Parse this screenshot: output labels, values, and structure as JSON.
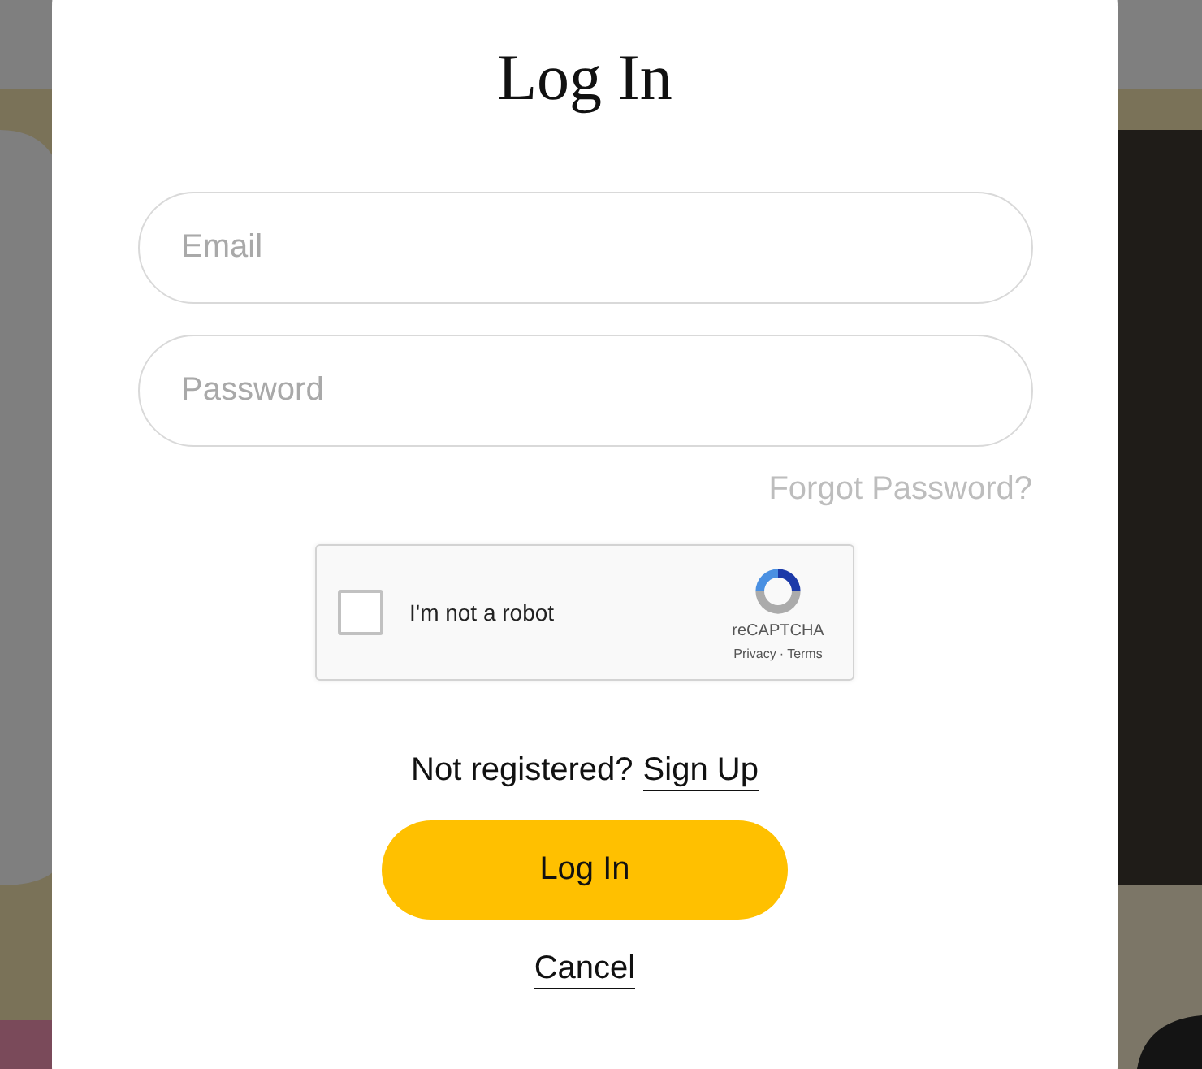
{
  "dialog": {
    "title": "Log In"
  },
  "fields": [
    {
      "placeholder": "Email"
    },
    {
      "placeholder": "Password"
    }
  ],
  "forgot_link": "Forgot Password?",
  "captcha": {
    "label": "I'm not a robot",
    "checked": false,
    "brand": "reCAPTCHA",
    "privacy": "Privacy",
    "separator": "·",
    "terms": "Terms"
  },
  "signup": {
    "prompt": "Not registered?",
    "link": "Sign Up"
  },
  "submit_button": "Log In",
  "cancel_link": "Cancel"
}
